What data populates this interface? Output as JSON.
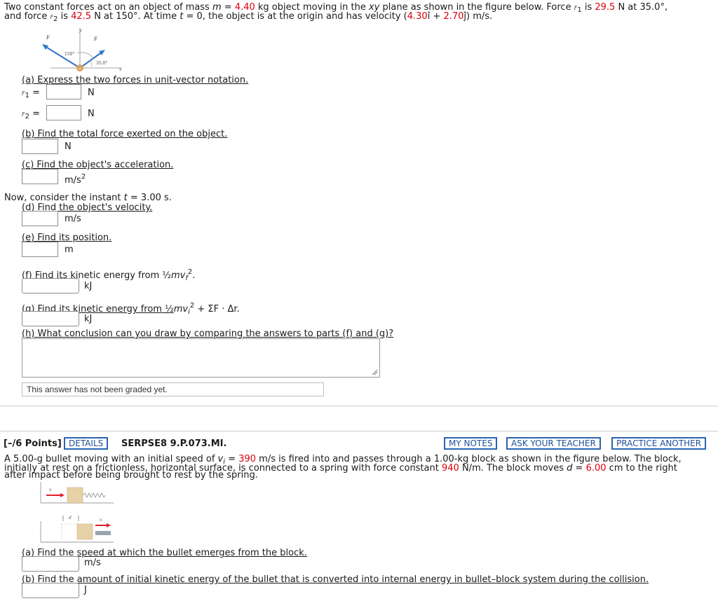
{
  "problem1": {
    "intro_line1": {
      "a": "Two constant forces act on an object of mass ",
      "m_sym": "m",
      "eq": " = ",
      "mass": "4.40",
      "b": " kg object moving in the ",
      "xy": "xy",
      "c": " plane as shown in the figure below. Force ",
      "f1_sub": "1",
      "d": " is ",
      "f1_mag": "29.5",
      "e": " N at ",
      "f1_ang": "35.0°,"
    },
    "intro_line2": {
      "a": "and force ",
      "f2_sub": "2",
      "b": " is ",
      "f2_mag": "42.5",
      "c": " N at 150°. At time ",
      "t_sym": "t",
      "d": " = 0, the object is at the origin and has velocity (",
      "vx": "4.30",
      "e": "î + ",
      "vy": "2.70",
      "f": "ĵ) m/s."
    },
    "figure": {
      "label_150": "150°",
      "label_35": "35.0°",
      "label_F2": "F",
      "label_F1": "F",
      "label_x": "x",
      "label_y": "y",
      "label_m": "m"
    },
    "part_a": {
      "label": "(a) Express the two forces in unit-vector notation."
    },
    "f1_row": {
      "sym": "F",
      "sub": "1",
      "eq": " =",
      "unit": "N"
    },
    "f2_row": {
      "sym": "F",
      "sub": "2",
      "eq": " =",
      "unit": "N"
    },
    "part_b": {
      "label": "(b) Find the total force exerted on the object.",
      "unit": "N"
    },
    "part_c": {
      "label": "(c) Find the object's acceleration.",
      "unit": "m/s",
      "unit_sup": "2"
    },
    "now_line": {
      "a": "Now, consider the instant ",
      "t_sym": "t",
      "b": " = 3.00 s."
    },
    "part_d": {
      "label": "(d) Find the object's velocity.",
      "unit": "m/s"
    },
    "part_e": {
      "label": "(e) Find its position.",
      "unit": "m"
    },
    "part_f": {
      "a": "(f) Find its kinetic energy from ½",
      "mv": "mv",
      "sub": "f",
      "sup": "2",
      "b": ".",
      "unit": "kJ"
    },
    "part_g": {
      "a": "(g) Find its kinetic energy from ½",
      "mv": "mv",
      "sub": "i",
      "sup": "2",
      "b": " + ΣF · Δr.",
      "unit": "kJ"
    },
    "part_h": {
      "label": "(h) What conclusion can you draw by comparing the answers to parts (f) and (g)?"
    },
    "graded_note": "This answer has not been graded yet."
  },
  "problem2": {
    "points": "[–/6 Points]",
    "details_btn": "DETAILS",
    "code": "SERPSE8 9.P.073.MI.",
    "my_notes_btn": "MY NOTES",
    "ask_teacher_btn": "ASK YOUR TEACHER",
    "practice_btn": "PRACTICE ANOTHER",
    "text_line1": {
      "a": "A 5.00-g bullet moving with an initial speed of ",
      "v_sym": "v",
      "v_sub": "i",
      "b": " = ",
      "speed": "390",
      "c": " m/s is fired into and passes through a 1.00-kg block as shown in the figure below. The block,"
    },
    "text_line2": {
      "a": "initially at rest on a frictionless, horizontal surface, is connected to a spring with force constant ",
      "k": "940",
      "b": " N/m. The block moves ",
      "d_sym": "d",
      "c": " = ",
      "d_val": "6.00",
      "e": " cm to the right"
    },
    "text_line3": "after impact before being brought to rest by the spring.",
    "figure": {
      "label_d": "d",
      "label_vi": "v",
      "label_vf": "v"
    },
    "part_a": {
      "label": "(a) Find the speed at which the bullet emerges from the block.",
      "unit": "m/s"
    },
    "part_b": {
      "label": "(b) Find the amount of initial kinetic energy of the bullet that is converted into internal energy in bullet–block system during the collision.",
      "unit": "J"
    }
  }
}
